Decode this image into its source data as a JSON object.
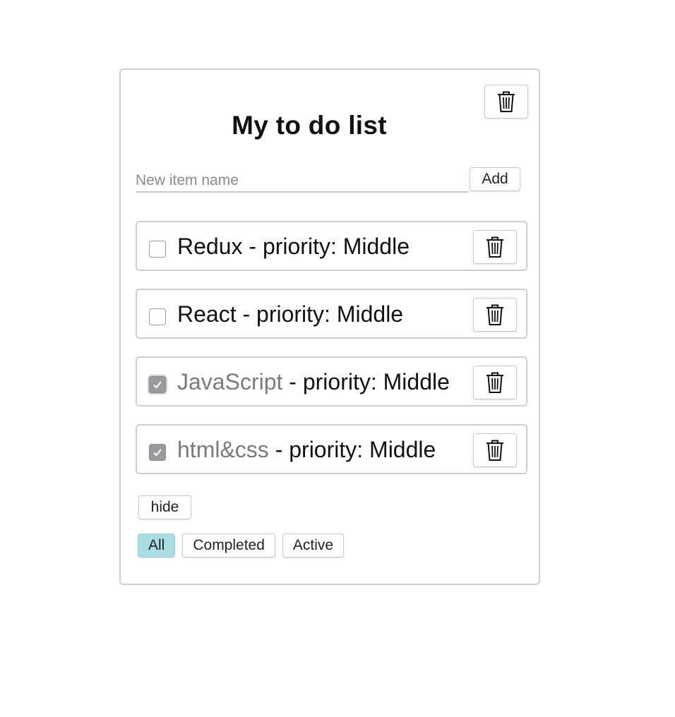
{
  "todolist": {
    "title": "My to do list",
    "input_placeholder": "New item name",
    "input_value": "",
    "add_label": "Add",
    "items": [
      {
        "name": "Redux",
        "separator": " - priority: ",
        "priority": "Middle",
        "done": false
      },
      {
        "name": "React",
        "separator": " - priority: ",
        "priority": "Middle",
        "done": false
      },
      {
        "name": "JavaScript",
        "separator": " - priority: ",
        "priority": "Middle",
        "done": true
      },
      {
        "name": "html&css",
        "separator": " - priority: ",
        "priority": "Middle",
        "done": true
      }
    ],
    "hide_label": "hide",
    "filters": [
      {
        "label": "All",
        "active": true
      },
      {
        "label": "Completed",
        "active": false
      },
      {
        "label": "Active",
        "active": false
      }
    ]
  },
  "icons": {
    "delete": "trash-icon",
    "check": "checkmark-icon"
  },
  "colors": {
    "active_filter": "#a9dce3",
    "border": "#cfcfcf",
    "done_text": "#7a7a7a",
    "checked_box": "#9a9a9e"
  }
}
